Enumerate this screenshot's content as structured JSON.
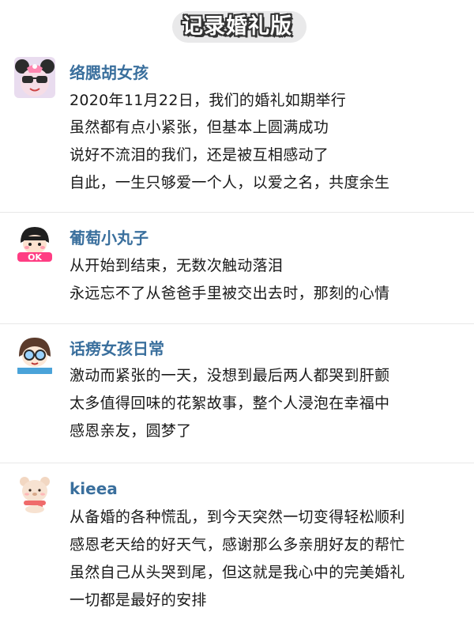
{
  "page_title": "记录婚礼版",
  "posts": [
    {
      "username": "络腮胡女孩",
      "avatar_icon": "sunglasses-minnie-avatar-icon",
      "lines": [
        "2020年11月22日，我们的婚礼如期举行",
        "虽然都有点小紧张，但基本上圆满成功",
        "说好不流泪的我们，还是被互相感动了",
        "自此，一生只够爱一个人，以爱之名，共度余生"
      ]
    },
    {
      "username": "葡萄小丸子",
      "avatar_icon": "chibi-maruko-ok-avatar-icon",
      "lines": [
        "从开始到结束，无数次触动落泪",
        "永远忘不了从爸爸手里被交出去时，那刻的心情"
      ]
    },
    {
      "username": "话痨女孩日常",
      "avatar_icon": "glasses-girl-avatar-icon",
      "lines": [
        "激动而紧张的一天，没想到最后两人都哭到肝颤",
        "太多值得回味的花絮故事，整个人浸泡在幸福中",
        "感恩亲友，圆梦了"
      ]
    },
    {
      "username": "kieea",
      "avatar_icon": "scarf-bear-avatar-icon",
      "lines": [
        "从备婚的各种慌乱，到今天突然一切变得轻松顺利",
        "感恩老天给的好天气，感谢那么多亲朋好友的帮忙",
        "虽然自己从头哭到尾，但这就是我心中的完美婚礼",
        "一切都是最好的安排"
      ]
    }
  ]
}
